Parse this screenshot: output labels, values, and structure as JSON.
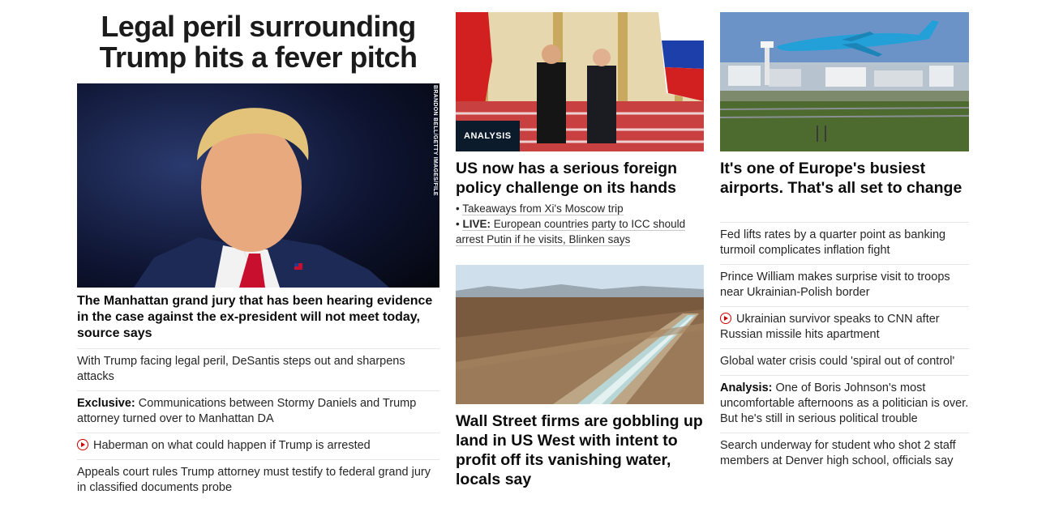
{
  "lead": {
    "title": "Legal peril surrounding Trump hits a fever pitch",
    "image_credit": "BRANDON BELL/GETTY IMAGES/FILE",
    "subheadline": "The Manhattan grand jury that has been hearing evidence in the case against the ex-president will not meet today, source says",
    "related": [
      {
        "prefix": "",
        "text": "With Trump facing legal peril, DeSantis steps out and sharpens attacks",
        "video": false
      },
      {
        "prefix": "Exclusive:",
        "text": " Communications between Stormy Daniels and Trump attorney turned over to Manhattan DA",
        "video": false
      },
      {
        "prefix": "",
        "text": "Haberman on what could happen if Trump is arrested",
        "video": true
      },
      {
        "prefix": "",
        "text": "Appeals court rules Trump attorney must testify to federal grand jury in classified documents probe",
        "video": false
      }
    ]
  },
  "middle": {
    "story1": {
      "badge": "ANALYSIS",
      "headline": "US now has a serious foreign policy challenge on its hands",
      "bullets": [
        {
          "prefix": "",
          "text": "Takeaways from Xi's Moscow trip"
        },
        {
          "prefix": "LIVE:",
          "text": " European countries party to ICC should arrest Putin if he visits, Blinken says"
        }
      ]
    },
    "story2": {
      "headline": "Wall Street firms are gobbling up land in US West with intent to profit off its vanishing water, locals say"
    }
  },
  "right": {
    "story1": {
      "headline": "It's one of Europe's busiest airports. That's all set to change"
    },
    "list": [
      {
        "prefix": "",
        "text": "Fed lifts rates by a quarter point as banking turmoil complicates inflation fight",
        "video": false
      },
      {
        "prefix": "",
        "text": "Prince William makes surprise visit to troops near Ukrainian-Polish border",
        "video": false
      },
      {
        "prefix": "",
        "text": "Ukrainian survivor speaks to CNN after Russian missile hits apartment",
        "video": true
      },
      {
        "prefix": "",
        "text": "Global water crisis could 'spiral out of control'",
        "video": false
      },
      {
        "prefix": "Analysis:",
        "text": " One of Boris Johnson's most uncomfortable afternoons as a politician is over. But he's still in serious political trouble",
        "video": false
      },
      {
        "prefix": "",
        "text": "Search underway for student who shot 2 staff members at Denver high school, officials say",
        "video": false
      }
    ]
  }
}
